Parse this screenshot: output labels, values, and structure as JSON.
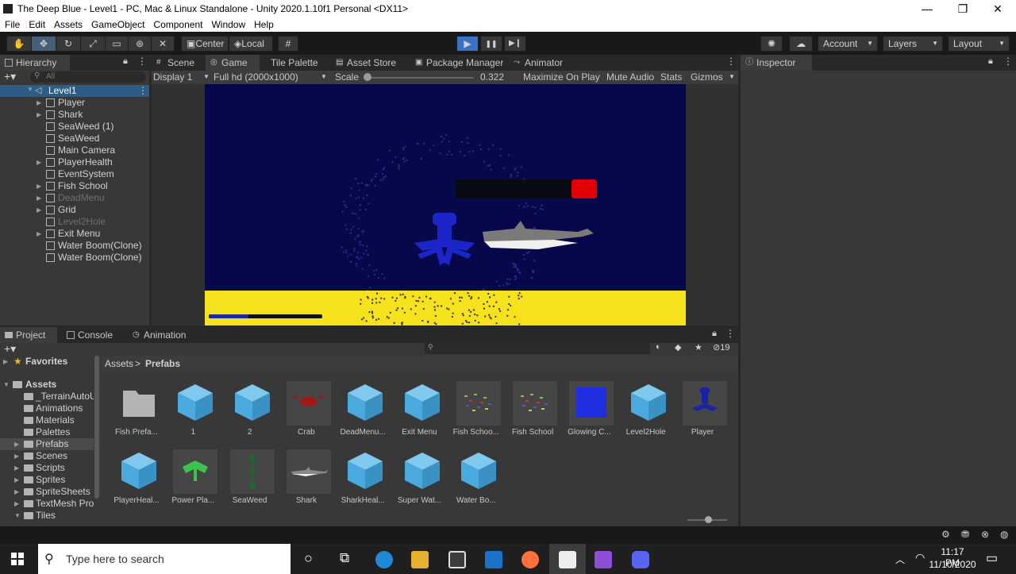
{
  "window": {
    "title": "The Deep Blue - Level1 - PC, Mac & Linux Standalone - Unity 2020.1.10f1 Personal <DX11>",
    "minimize": "—",
    "maximize": "❐",
    "close": "✕"
  },
  "menu": [
    "File",
    "Edit",
    "Assets",
    "GameObject",
    "Component",
    "Window",
    "Help"
  ],
  "toolbar": {
    "center": "Center",
    "local": "Local",
    "account": "Account",
    "layers": "Layers",
    "layout": "Layout",
    "play": "▶",
    "pause": "❚❚",
    "step": "▶❙"
  },
  "hierarchy": {
    "tab": "Hierarchy",
    "search_placeholder": "All",
    "scene": "Level1",
    "items": [
      {
        "label": "Player",
        "arrow": "▶",
        "dim": false
      },
      {
        "label": "Shark",
        "arrow": "▶",
        "dim": false
      },
      {
        "label": "SeaWeed (1)",
        "arrow": "",
        "dim": false
      },
      {
        "label": "SeaWeed",
        "arrow": "",
        "dim": false
      },
      {
        "label": "Main Camera",
        "arrow": "",
        "dim": false
      },
      {
        "label": "PlayerHealth",
        "arrow": "▶",
        "dim": false
      },
      {
        "label": "EventSystem",
        "arrow": "",
        "dim": false
      },
      {
        "label": "Fish School",
        "arrow": "▶",
        "dim": false
      },
      {
        "label": "DeadMenu",
        "arrow": "▶",
        "dim": true
      },
      {
        "label": "Grid",
        "arrow": "▶",
        "dim": false
      },
      {
        "label": "Level2Hole",
        "arrow": "",
        "dim": true
      },
      {
        "label": "Exit Menu",
        "arrow": "▶",
        "dim": false
      },
      {
        "label": "Water Boom(Clone)",
        "arrow": "",
        "dim": false
      },
      {
        "label": "Water Boom(Clone)",
        "arrow": "",
        "dim": false
      }
    ]
  },
  "center_tabs": [
    "Scene",
    "Game",
    "Tile Palette",
    "Asset Store",
    "Package Manager",
    "Animator"
  ],
  "game_toolbar": {
    "display": "Display 1",
    "resolution": "Full hd (2000x1000)",
    "scale_label": "Scale",
    "scale_value": "0.322",
    "maximize": "Maximize On Play",
    "mute": "Mute Audio",
    "stats": "Stats",
    "gizmos": "Gizmos"
  },
  "inspector": {
    "tab": "Inspector"
  },
  "bottom_tabs": [
    "Project",
    "Console",
    "Animation"
  ],
  "project": {
    "hidden_count": "19",
    "breadcrumb_root": "Assets",
    "breadcrumb_sep": ">",
    "breadcrumb_leaf": "Prefabs",
    "favorites": "Favorites",
    "assets_root": "Assets",
    "folders": [
      "_TerrainAutoU",
      "Animations",
      "Materials",
      "Palettes",
      "Prefabs",
      "Scenes",
      "Scripts",
      "Sprites",
      "SpriteSheets",
      "TextMesh Pro",
      "Tiles"
    ],
    "assets_row1": [
      "Fish Prefa...",
      "1",
      "2",
      "Crab",
      "DeadMenu...",
      "Exit Menu",
      "Fish Schoo...",
      "Fish School",
      "Glowing C...",
      "Level2Hole",
      "Player"
    ],
    "assets_row2": [
      "PlayerHeal...",
      "Power Pla...",
      "SeaWeed",
      "Shark",
      "SharkHeal...",
      "Super Wat...",
      "Water Bo..."
    ]
  },
  "taskbar": {
    "search_placeholder": "Type here to search",
    "time": "11:17 PM",
    "date": "11/10/2020"
  },
  "colors": {
    "accent": "#3a72c4",
    "game_bg": "#06084a",
    "sand": "#f5e21c",
    "health_red": "#e30000",
    "cube": "#4aa9dd"
  }
}
